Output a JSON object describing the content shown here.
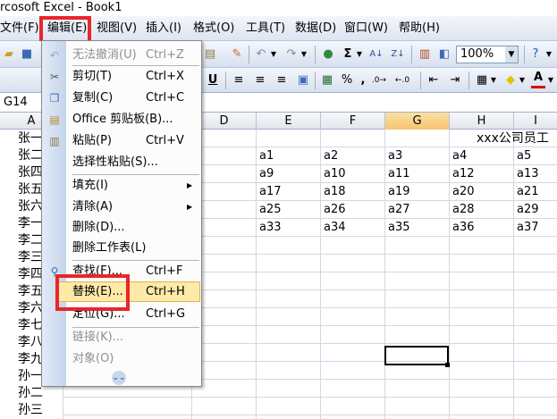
{
  "window": {
    "title": "rcosoft Excel - Book1"
  },
  "menubar": {
    "items": [
      "文件(F)",
      "编辑(E)",
      "视图(V)",
      "插入(I)",
      "格式(O)",
      "工具(T)",
      "数据(D)",
      "窗口(W)",
      "帮助(H)"
    ]
  },
  "toolbar": {
    "sigma": "Σ",
    "zoom": "100%",
    "underline": "U",
    "percent": "%",
    "comma": ","
  },
  "namebox": {
    "value": "G14"
  },
  "columns": [
    "A",
    "D",
    "E",
    "F",
    "G",
    "H",
    "I"
  ],
  "rows_a": [
    "张一",
    "张二",
    "张四",
    "张五",
    "张六",
    "李一",
    "李二",
    "李三",
    "李四",
    "李五",
    "李六",
    "李七",
    "李八",
    "李九",
    "孙一",
    "孙二",
    "孙三"
  ],
  "sheet": {
    "title_cell": "xxx公司员工",
    "rows": [
      [
        "a1",
        "a2",
        "a3",
        "a4",
        "a5"
      ],
      [
        "a9",
        "a10",
        "a11",
        "a12",
        "a13"
      ],
      [
        "a17",
        "a18",
        "a19",
        "a20",
        "a21"
      ],
      [
        "a25",
        "a26",
        "a27",
        "a28",
        "a29"
      ],
      [
        "a33",
        "a34",
        "a35",
        "a36",
        "a37"
      ]
    ]
  },
  "edit_menu": {
    "undo": {
      "label": "无法撤消(U)",
      "shortcut": "Ctrl+Z"
    },
    "cut": {
      "label": "剪切(T)",
      "shortcut": "Ctrl+X"
    },
    "copy": {
      "label": "复制(C)",
      "shortcut": "Ctrl+C"
    },
    "clipboard": {
      "label": "Office 剪贴板(B)..."
    },
    "paste": {
      "label": "粘贴(P)",
      "shortcut": "Ctrl+V"
    },
    "paste_special": {
      "label": "选择性粘贴(S)..."
    },
    "fill": {
      "label": "填充(I)"
    },
    "clear": {
      "label": "清除(A)"
    },
    "delete": {
      "label": "删除(D)..."
    },
    "delete_sheet": {
      "label": "删除工作表(L)"
    },
    "find": {
      "label": "查找(F)...",
      "shortcut": "Ctrl+F"
    },
    "replace": {
      "label": "替换(E)...",
      "shortcut": "Ctrl+H"
    },
    "goto": {
      "label": "定位(G)...",
      "shortcut": "Ctrl+G"
    },
    "links": {
      "label": "链接(K)..."
    },
    "object": {
      "label": "对象(O)"
    }
  },
  "colors": {
    "highlight_box": "#e8262c",
    "menu_hover": "#fde9a8",
    "selected_col": "#f6c46b"
  }
}
